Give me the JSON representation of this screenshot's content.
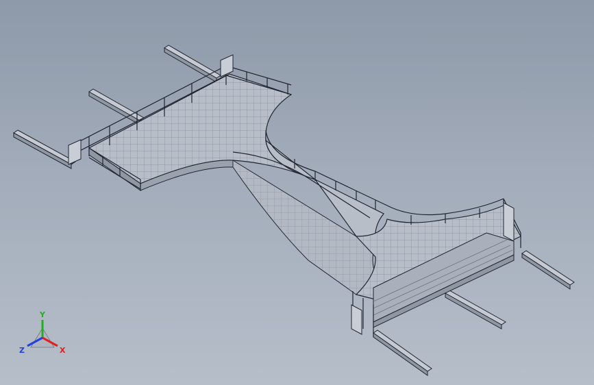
{
  "app": "cad-3d-viewport",
  "viewport": {
    "background_top": "#8e99a9",
    "background_bottom": "#b6bec9",
    "model": "steel-platform-walkway-with-handrails",
    "edge_color": "#1f2530",
    "face_light": "#c9ced6",
    "face_mid": "#b3b9c3",
    "face_dark": "#8f97a3"
  },
  "triad": {
    "x_label": "X",
    "y_label": "Y",
    "z_label": "Z",
    "x_color": "#e02020",
    "y_color": "#20b020",
    "z_color": "#2040e0"
  }
}
